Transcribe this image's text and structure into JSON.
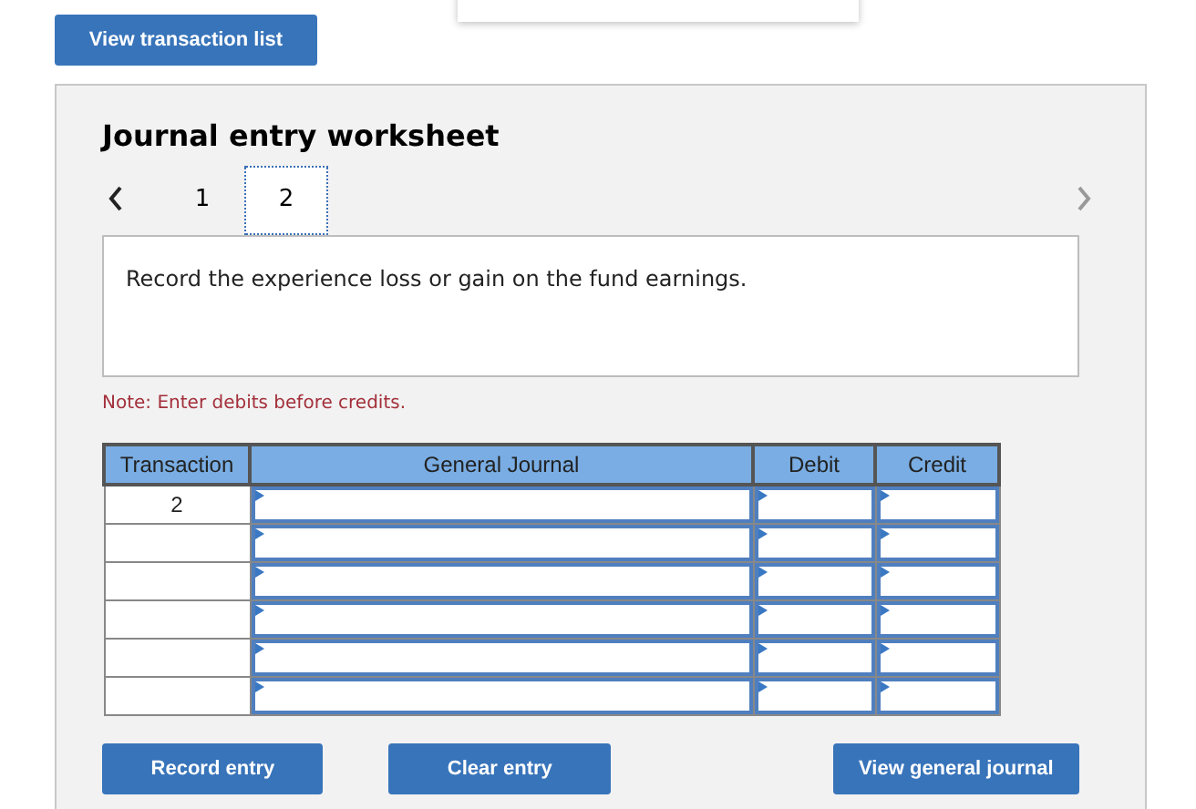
{
  "top_button": "View transaction list",
  "worksheet": {
    "title": "Journal entry worksheet",
    "tabs": [
      {
        "label": "1",
        "selected": false
      },
      {
        "label": "2",
        "selected": true
      }
    ],
    "prompt": "Record the experience loss or gain on the fund earnings.",
    "note": "Note: Enter debits before credits.",
    "table": {
      "columns": [
        "Transaction",
        "General Journal",
        "Debit",
        "Credit"
      ],
      "rows": [
        {
          "transaction": "2"
        },
        {
          "transaction": ""
        },
        {
          "transaction": ""
        },
        {
          "transaction": ""
        },
        {
          "transaction": ""
        },
        {
          "transaction": ""
        }
      ]
    },
    "buttons": [
      "Record entry",
      "Clear entry",
      "View general journal"
    ]
  }
}
